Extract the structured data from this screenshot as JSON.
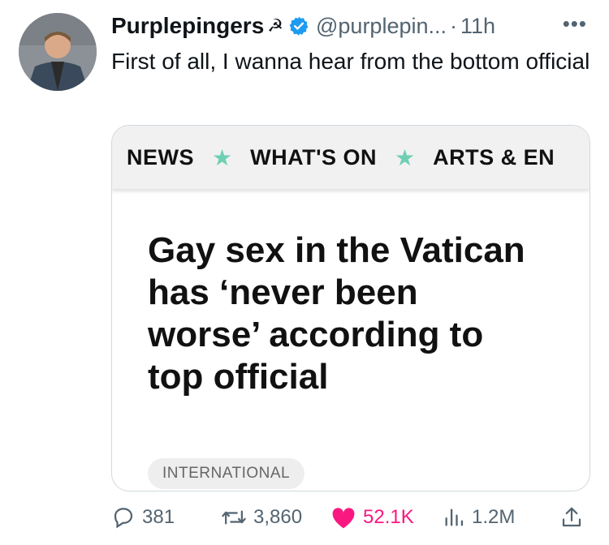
{
  "author": {
    "display_name": "Purplepingers",
    "emoji": "☭",
    "handle": "@purplepin...",
    "separator": "·",
    "time": "11h"
  },
  "tweet": {
    "text": "First of all, I wanna hear from the bottom official"
  },
  "card": {
    "nav_items": [
      "NEWS",
      "WHAT'S ON",
      "ARTS & EN"
    ],
    "nav_separator": "★",
    "headline": "Gay sex in the Vatican has ‘never been worse’ according to top official",
    "category": "INTERNATIONAL"
  },
  "actions": {
    "replies": "381",
    "retweets": "3,860",
    "likes": "52.1K",
    "views": "1.2M"
  },
  "colors": {
    "verified": "#1d9bf0",
    "like": "#f91880",
    "nav_star": "#6fcfb4",
    "muted": "#536471"
  },
  "icons": [
    "more-icon",
    "verified-icon",
    "reply-icon",
    "retweet-icon",
    "heart-icon",
    "views-icon",
    "share-icon"
  ]
}
